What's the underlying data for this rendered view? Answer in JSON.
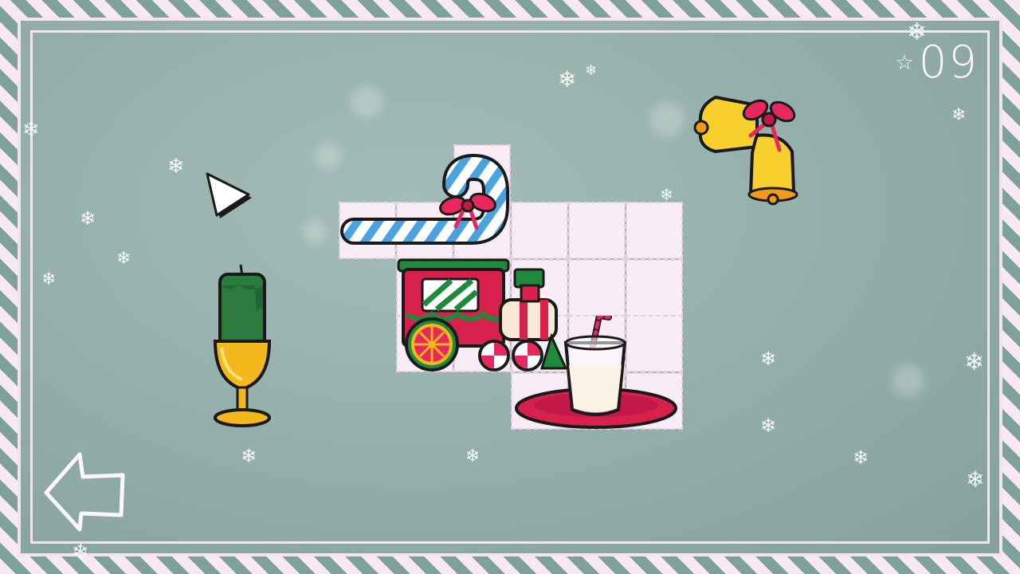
{
  "hud": {
    "star_glyph": "☆",
    "level_number": "09"
  },
  "controls": {
    "back_icon": "back-arrow-icon"
  },
  "pieces": [
    {
      "name": "candy-cane",
      "icon": "candy-cane-icon"
    },
    {
      "name": "toy-train",
      "icon": "train-icon"
    },
    {
      "name": "milk-glass",
      "icon": "milk-glass-icon"
    },
    {
      "name": "candle",
      "icon": "candle-icon"
    },
    {
      "name": "jingle-bells",
      "icon": "bells-icon"
    }
  ],
  "colors": {
    "border_stripe_light": "#f7e8f4",
    "border_stripe_dark": "#7fa19b",
    "board_bg": "#93aeaa",
    "grid_cell": "#f8edf7",
    "candy_red": "#e8285c",
    "candy_blue": "#4aa3e0",
    "train_red": "#d8204d",
    "train_green": "#1f8a3c",
    "bell_yellow": "#f7d02e",
    "candle_green": "#2b7a3e",
    "gold": "#f2b81c"
  }
}
